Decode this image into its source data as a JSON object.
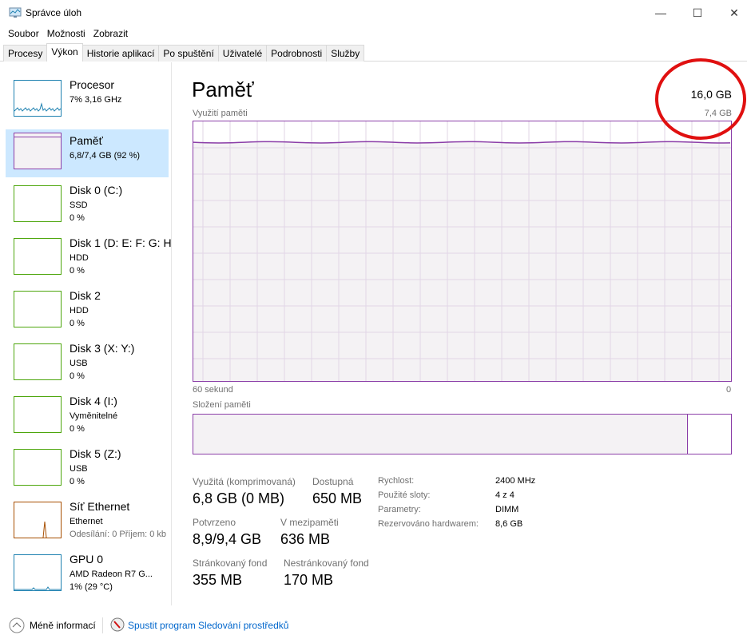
{
  "window": {
    "title": "Správce úloh",
    "icon": "task-manager-icon",
    "controls": [
      "minimize",
      "maximize",
      "close"
    ]
  },
  "menu": [
    "Soubor",
    "Možnosti",
    "Zobrazit"
  ],
  "tabs": [
    {
      "label": "Procesy"
    },
    {
      "label": "Výkon",
      "active": true
    },
    {
      "label": "Historie aplikací"
    },
    {
      "label": "Po spuštění"
    },
    {
      "label": "Uživatelé"
    },
    {
      "label": "Podrobnosti"
    },
    {
      "label": "Služby"
    }
  ],
  "sidebar": [
    {
      "name": "Procesor",
      "sub1": "7% 3,16 GHz",
      "color": "#1e81b0"
    },
    {
      "name": "Paměť",
      "sub1": "6,8/7,4 GB (92 %)",
      "color": "#8b3ea8",
      "selected": true,
      "usage_percent": 92
    },
    {
      "name": "Disk 0 (C:)",
      "sub1": "SSD",
      "sub2": "0 %",
      "color": "#4da60c"
    },
    {
      "name": "Disk 1 (D: E: F: G: H",
      "sub1": "HDD",
      "sub2": "0 %",
      "color": "#4da60c"
    },
    {
      "name": "Disk 2",
      "sub1": "HDD",
      "sub2": "0 %",
      "color": "#4da60c"
    },
    {
      "name": "Disk 3 (X: Y:)",
      "sub1": "USB",
      "sub2": "0 %",
      "color": "#4da60c"
    },
    {
      "name": "Disk 4 (I:)",
      "sub1": "Vyměnitelné",
      "sub2": "0 %",
      "color": "#4da60c"
    },
    {
      "name": "Disk 5 (Z:)",
      "sub1": "USB",
      "sub2": "0 %",
      "color": "#4da60c"
    },
    {
      "name": "Síť Ethernet",
      "sub1": "Ethernet",
      "sub2": "Odesílání: 0 Příjem: 0 kb",
      "color": "#a74f01"
    },
    {
      "name": "GPU 0",
      "sub1": "AMD Radeon R7 G...",
      "sub2": "1% (29 °C)",
      "color": "#1e81b0"
    }
  ],
  "main": {
    "title": "Paměť",
    "total": "16,0 GB",
    "usage_label": "Využití paměti",
    "usage_max": "7,4 GB",
    "time_left": "60 sekund",
    "time_right": "0",
    "usage_percent": 92,
    "composition_label": "Složení paměti",
    "composition_in_use_percent": 92,
    "stats": [
      {
        "label": "Využitá (komprimovaná)",
        "value": "6,8 GB (0 MB)"
      },
      {
        "label": "Dostupná",
        "value": "650 MB"
      },
      {
        "label": "Potvrzeno",
        "value": "8,9/9,4 GB"
      },
      {
        "label": "V mezipaměti",
        "value": "636 MB"
      },
      {
        "label": "Stránkovaný fond",
        "value": "355 MB"
      },
      {
        "label": "Nestránkovaný fond",
        "value": "170 MB"
      }
    ],
    "details": [
      {
        "label": "Rychlost:",
        "value": "2400 MHz"
      },
      {
        "label": "Použité sloty:",
        "value": "4 z 4"
      },
      {
        "label": "Parametry:",
        "value": "DIMM"
      },
      {
        "label": "Rezervováno hardwarem:",
        "value": "8,6 GB"
      }
    ],
    "accent": "#8b3ea8",
    "annotation_color": "#e01010"
  },
  "footer": {
    "less": "Méně informací",
    "monitor": "Spustit program Sledování prostředků"
  }
}
